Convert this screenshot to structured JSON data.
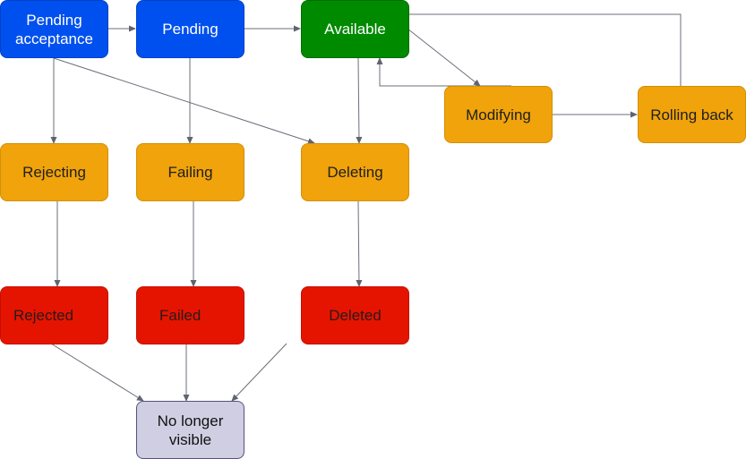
{
  "diagram": {
    "title": "",
    "nodes": [
      {
        "id": "pending-acceptance",
        "label": "Pending\nacceptance",
        "color": "blue"
      },
      {
        "id": "pending",
        "label": "Pending",
        "color": "blue"
      },
      {
        "id": "available",
        "label": "Available",
        "color": "green"
      },
      {
        "id": "modifying",
        "label": "Modifying",
        "color": "orange"
      },
      {
        "id": "rolling-back",
        "label": "Rolling back",
        "color": "orange"
      },
      {
        "id": "rejecting",
        "label": "Rejecting",
        "color": "orange"
      },
      {
        "id": "failing",
        "label": "Failing",
        "color": "orange"
      },
      {
        "id": "deleting",
        "label": "Deleting",
        "color": "orange"
      },
      {
        "id": "rejected",
        "label": "Rejected",
        "color": "red"
      },
      {
        "id": "failed",
        "label": "Failed",
        "color": "red"
      },
      {
        "id": "deleted",
        "label": "Deleted",
        "color": "red"
      },
      {
        "id": "no-longer-visible",
        "label": "No longer\nvisible",
        "color": "grey"
      }
    ],
    "edges": [
      {
        "from": "pending-acceptance",
        "to": "pending"
      },
      {
        "from": "pending",
        "to": "available"
      },
      {
        "from": "pending-acceptance",
        "to": "rejecting"
      },
      {
        "from": "pending-acceptance",
        "to": "deleting"
      },
      {
        "from": "pending",
        "to": "failing"
      },
      {
        "from": "available",
        "to": "deleting"
      },
      {
        "from": "available",
        "to": "modifying"
      },
      {
        "from": "modifying",
        "to": "available"
      },
      {
        "from": "modifying",
        "to": "rolling-back"
      },
      {
        "from": "rolling-back",
        "to": "available"
      },
      {
        "from": "rejecting",
        "to": "rejected"
      },
      {
        "from": "failing",
        "to": "failed"
      },
      {
        "from": "deleting",
        "to": "deleted"
      },
      {
        "from": "rejected",
        "to": "no-longer-visible"
      },
      {
        "from": "failed",
        "to": "no-longer-visible"
      },
      {
        "from": "deleted",
        "to": "no-longer-visible"
      }
    ],
    "colors": {
      "blue": "#0050ef",
      "green": "#008a00",
      "orange": "#f0a30a",
      "red": "#e51400",
      "grey": "#d0cee2",
      "edge": "#6b6f7a"
    }
  }
}
